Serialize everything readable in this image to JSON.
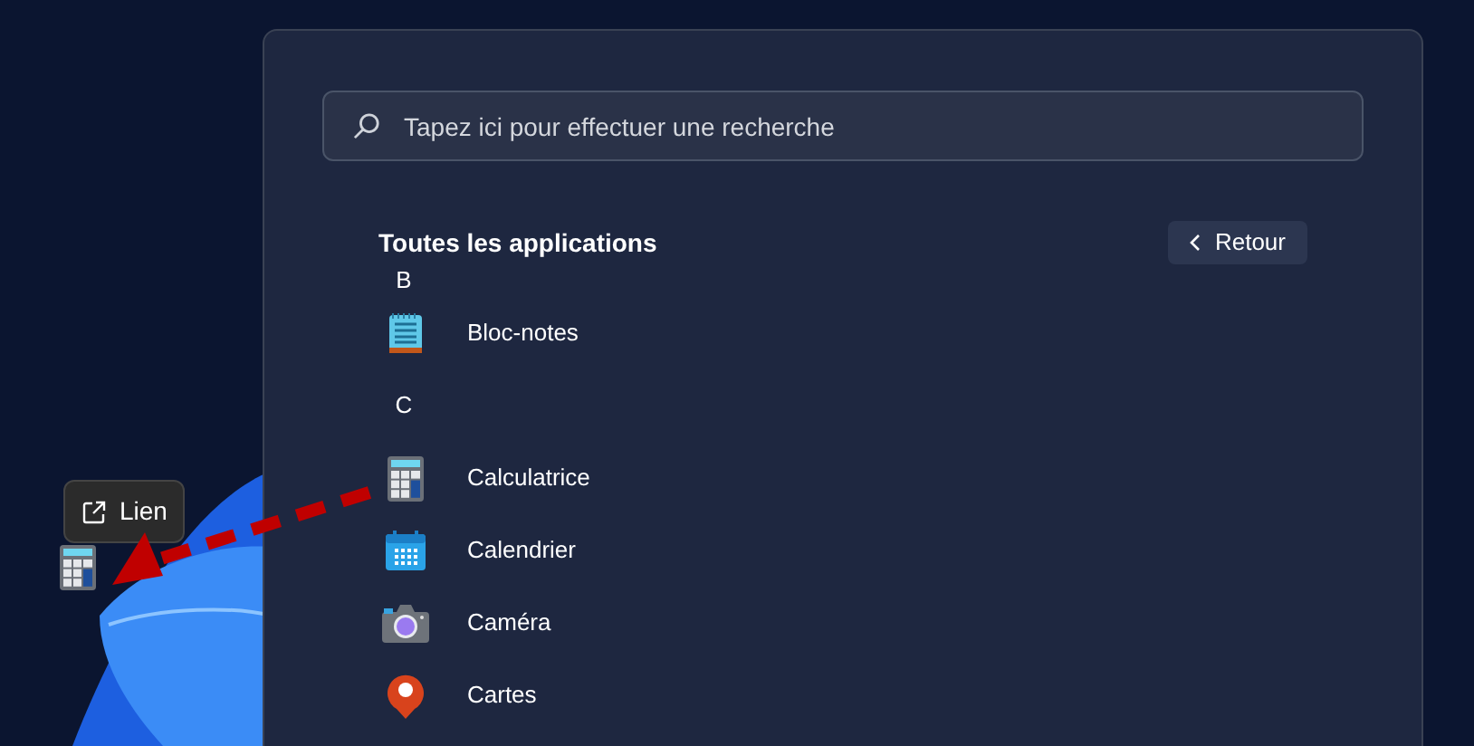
{
  "search": {
    "placeholder": "Tapez ici pour effectuer une recherche"
  },
  "header": {
    "title": "Toutes les applications",
    "back_button": "Retour"
  },
  "items": [
    {
      "kind": "letter",
      "label": "B"
    },
    {
      "kind": "app",
      "label": "Bloc-notes"
    },
    {
      "kind": "letter",
      "label": "C"
    },
    {
      "kind": "app",
      "label": "Calculatrice"
    },
    {
      "kind": "app",
      "label": "Calendrier"
    },
    {
      "kind": "app",
      "label": "Caméra"
    },
    {
      "kind": "app",
      "label": "Cartes"
    }
  ],
  "drag": {
    "tooltip": "Lien"
  }
}
